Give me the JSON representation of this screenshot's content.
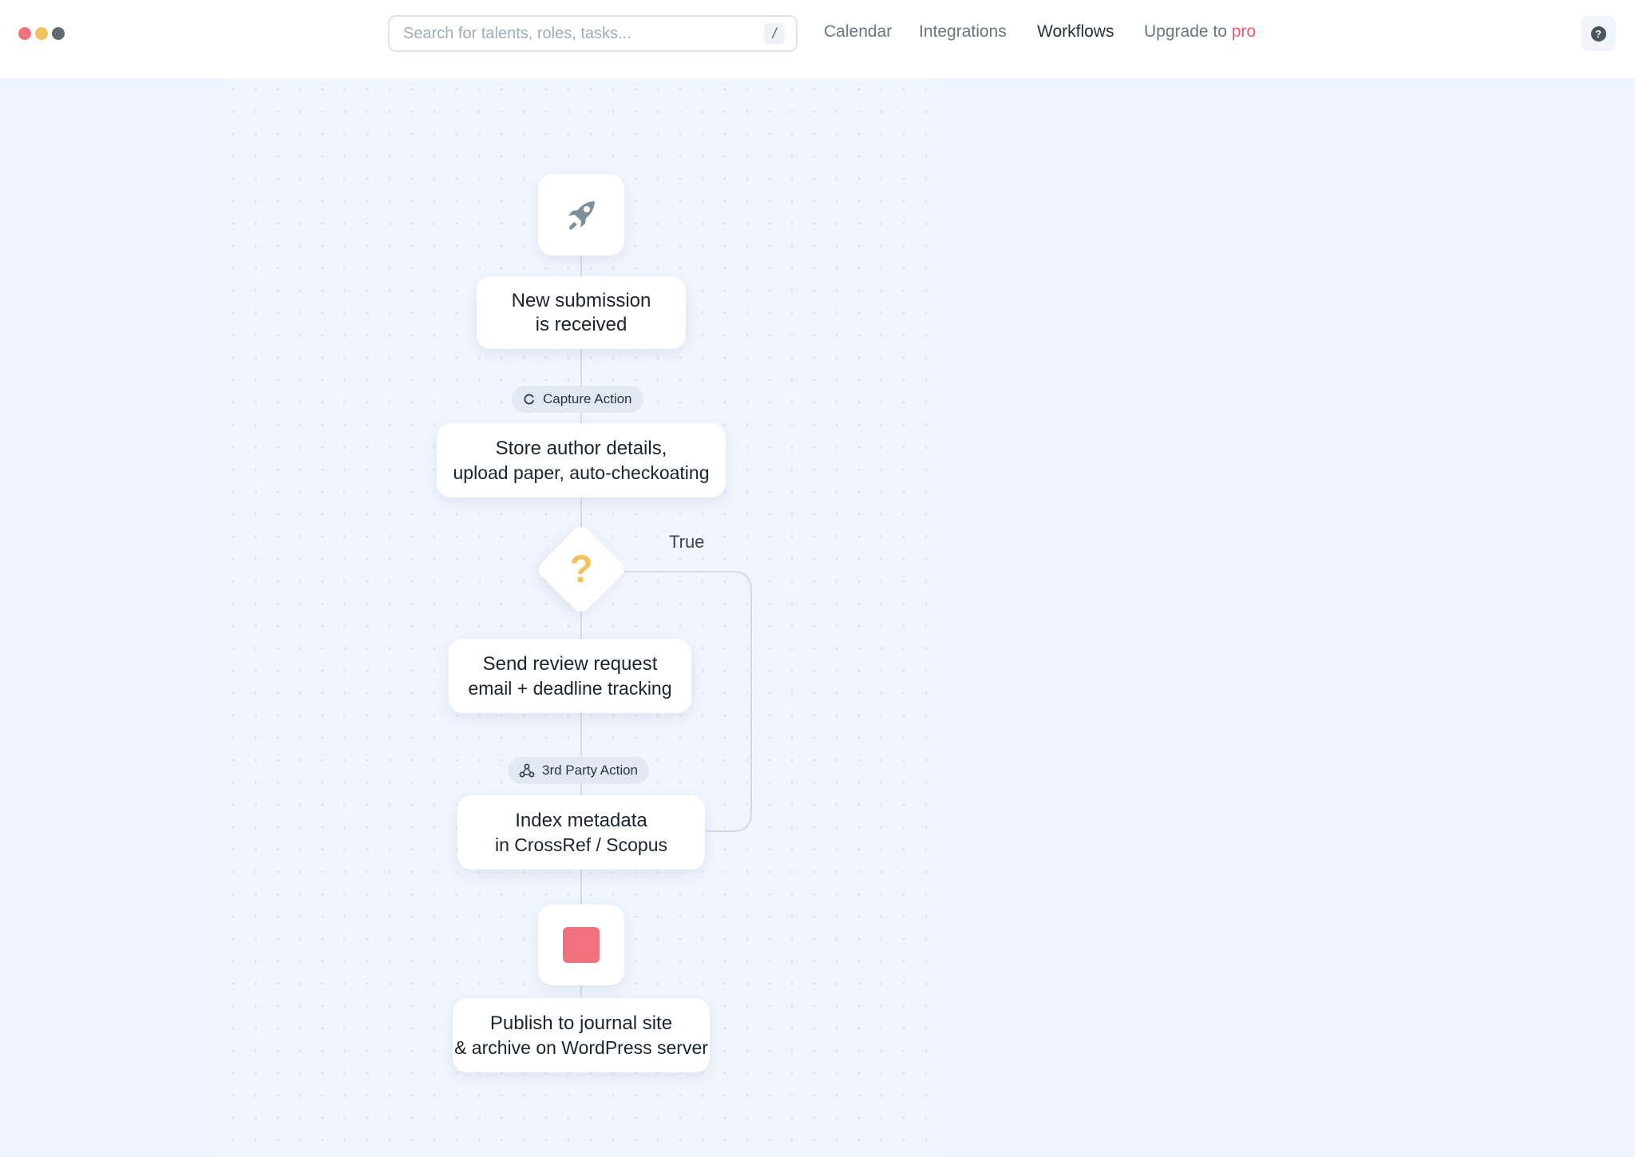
{
  "window": {
    "controls": [
      {
        "name": "close",
        "color": "#f3717f"
      },
      {
        "name": "minimize",
        "color": "#f2c25c"
      },
      {
        "name": "maximize",
        "color": "#5f6a75"
      }
    ]
  },
  "search": {
    "placeholder": "Search for talents, roles, tasks...",
    "shortcut": "/"
  },
  "nav": {
    "calendar": "Calendar",
    "integrations": "Integrations",
    "workflows": "Workflows",
    "upgrade_prefix": "Upgrade to",
    "upgrade_pro": "pro",
    "active": "Workflows"
  },
  "help": {
    "icon": "help-icon",
    "glyph": "?"
  },
  "workflow": {
    "start_icon": "rocket-icon",
    "trigger": {
      "line1": "New submission",
      "line2": "is received"
    },
    "capture_pill": {
      "icon": "refresh-icon",
      "label": "Capture Action"
    },
    "store_step": {
      "line1": "Store author details,",
      "line2": "upload paper, auto-checkoating"
    },
    "condition": {
      "icon": "question-icon",
      "glyph": "?",
      "branch_label": "True"
    },
    "review_step": {
      "line1": "Send review request",
      "line2": "email + deadline tracking"
    },
    "third_party_pill": {
      "icon": "webhook-icon",
      "label": "3rd Party Action"
    },
    "index_step": {
      "line1": "Index metadata",
      "line2": "in CrossRef / Scopus"
    },
    "end_icon": "stop-icon",
    "publish_step": {
      "line1": "Publish to journal site",
      "line2": "& archive on WordPress server"
    }
  },
  "colors": {
    "accent_pro": "#ef5b6e",
    "stop": "#f3717f",
    "question": "#f1c35a",
    "canvas_bg": "#f1f5fd",
    "page_bg": "#eef4fe"
  }
}
